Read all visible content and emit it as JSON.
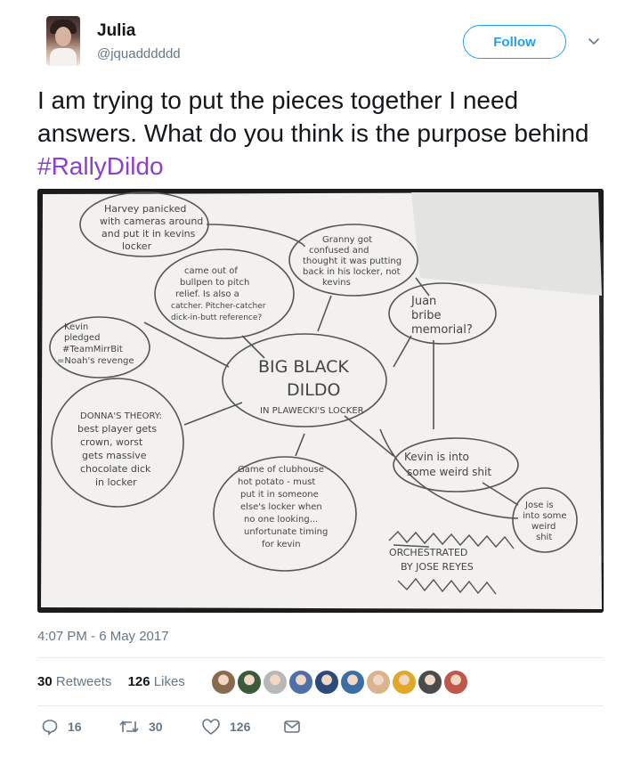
{
  "user": {
    "name": "Julia",
    "handle": "@jquadddddd",
    "follow_label": "Follow"
  },
  "tweet": {
    "text_before": "I am trying to put the pieces together I need answers. What do you think is the purpose behind ",
    "hashtag": "#RallyDildo",
    "timestamp": "4:07 PM - 6 May 2017"
  },
  "photo": {
    "notes": {
      "harvey": [
        "Harvey panicked",
        "with cameras around",
        "and put it in kevins",
        "locker"
      ],
      "granny": [
        "Granny got",
        "confused and",
        "thought it was putting",
        "back in his locker, not",
        "kevins"
      ],
      "bullpen": [
        "came out of",
        "bullpen to pitch",
        "relief. Is also a",
        "catcher. Pitcher-catcher",
        "dick-in-butt reference?"
      ],
      "kevin_pledged": [
        "Kevin",
        "pledged",
        "#TeamMirrBit",
        "=Noah's revenge"
      ],
      "juan": [
        "Juan",
        "bribe",
        "memorial?"
      ],
      "center": [
        "BIG BLACK",
        "DILDO",
        "IN PLAWECKI'S LOCKER"
      ],
      "donna": [
        "DONNA'S THEORY:",
        "best player gets",
        "crown, worst",
        "gets massive",
        "chocolate dick",
        "in locker"
      ],
      "clubhouse": [
        "Game of clubhouse",
        "hot potato - must",
        "put it in someone",
        "else's locker when",
        "no one looking...",
        "unfortunate timing",
        "for kevin"
      ],
      "kevin_weird": [
        "Kevin is into",
        "some weird shit"
      ],
      "jose": [
        "Jose is",
        "into some",
        "weird",
        "shit"
      ],
      "orchestrated": [
        "ORCHESTRATED",
        "BY JOSE REYES"
      ]
    }
  },
  "stats": {
    "retweets_count": "30",
    "retweets_label": "Retweets",
    "likes_count": "126",
    "likes_label": "Likes"
  },
  "likers": [
    "#8a6a4f",
    "#3d5a3a",
    "#b8b8b8",
    "#4f6fa8",
    "#2c4b7a",
    "#3b6ea5",
    "#d9b48f",
    "#e0a826",
    "#4a4a4a",
    "#c0574a"
  ],
  "actions": {
    "reply_count": "16",
    "retweet_count": "30",
    "like_count": "126"
  }
}
